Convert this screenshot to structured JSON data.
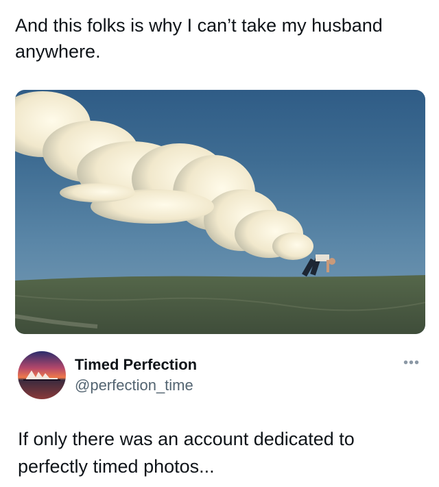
{
  "post": {
    "text": "And this folks is why I can’t take my husband anywhere."
  },
  "photo": {
    "icon": "cloud-photo"
  },
  "quoted": {
    "author_name": "Timed Perfection",
    "author_handle": "@perfection_time",
    "more_label": "•••",
    "text": "If only there was an account dedicated to perfectly timed photos..."
  },
  "colors": {
    "text": "#0f1419",
    "secondary": "#536471",
    "sky": "#3f6d93",
    "grass": "#4a5a44"
  }
}
